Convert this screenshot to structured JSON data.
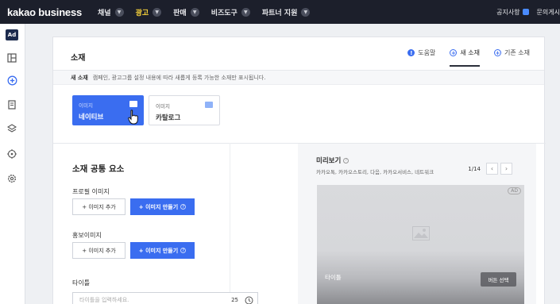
{
  "app": {
    "brand": "kakao business"
  },
  "topnav": {
    "items": [
      {
        "label": "채널",
        "active": false
      },
      {
        "label": "광고",
        "active": true
      },
      {
        "label": "판매",
        "active": false
      },
      {
        "label": "비즈도구",
        "active": false
      },
      {
        "label": "파트너 지원",
        "active": false
      }
    ],
    "notice_label": "공지사항",
    "inquiry_label": "문의게시"
  },
  "sidebar": {
    "logo": "Ad",
    "icons": [
      "layout-icon",
      "add-circle-icon",
      "document-icon",
      "layers-icon",
      "target-icon",
      "settings-icon"
    ]
  },
  "page": {
    "title": "소재",
    "links": [
      {
        "label": "도움말",
        "icon": "help-icon",
        "active": false
      },
      {
        "label": "새 소재",
        "icon": "plus-icon",
        "active": true
      },
      {
        "label": "기존 소재",
        "icon": "plus-icon",
        "active": false
      }
    ],
    "desc_prefix": "새 소재",
    "desc_text": "캠페인, 광고그룹 설정 내용에 따라 새롭게 등록 가능한 소재만 표시됩니다."
  },
  "creative_types": [
    {
      "sub": "이미지",
      "main": "네이티브",
      "selected": true
    },
    {
      "sub": "이미지",
      "main": "카탈로그",
      "selected": false
    }
  ],
  "common": {
    "section_title": "소재 공통 요소",
    "profile_label": "프로필 이미지",
    "promo_label": "홍보이미지",
    "add_image_label": "+ 이미지 추가",
    "make_image_label": "+ 이미지 만들기",
    "title_label": "타이틀",
    "title_placeholder": "타이틀을 입력하세요.",
    "title_counter": "25"
  },
  "preview": {
    "title": "미리보기",
    "placements": "카카오톡, 카카오스토리, 다음, 카카오서비스, 네트워크",
    "pager": "1/14",
    "ad_badge": "AD",
    "caption": "타이틀",
    "cta": "버튼 선택"
  },
  "colors": {
    "accent": "#3a6df0",
    "topbar": "#1c1f2b",
    "active_nav": "#ffd83b"
  }
}
